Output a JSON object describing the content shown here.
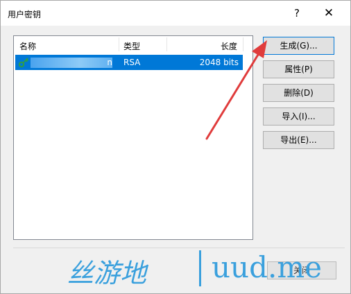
{
  "window": {
    "title": "用户密钥",
    "help_glyph": "?",
    "close_glyph": "✕"
  },
  "list": {
    "columns": [
      "名称",
      "类型",
      "长度"
    ],
    "rows": [
      {
        "name": "n",
        "type": "RSA",
        "length": "2048 bits",
        "selected": true,
        "icon": "key-icon"
      }
    ]
  },
  "buttons": {
    "generate": "生成(G)...",
    "properties": "属性(P)",
    "delete": "删除(D)",
    "import": "导入(I)...",
    "export": "导出(E)...",
    "close": "关闭"
  },
  "watermark": {
    "cn": "丝游地",
    "en": "uud.me"
  },
  "colors": {
    "selection": "#0078d7",
    "arrow": "#e03c3c",
    "watermark": "#3aa0dd"
  }
}
